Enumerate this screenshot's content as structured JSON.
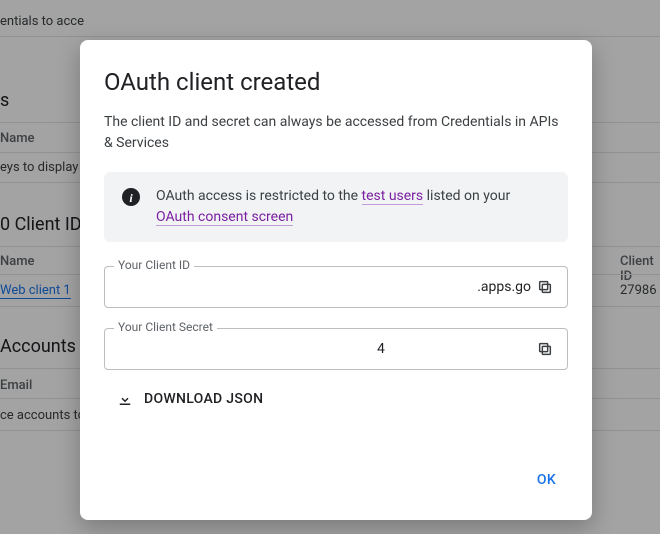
{
  "background": {
    "top_fragment": "entials to acce",
    "section1": {
      "title_suffix": "s",
      "col_name": "Name",
      "row1": "eys to display"
    },
    "section2": {
      "title_fragment": "0 Client ID",
      "col_name": "Name",
      "row_link": "Web client 1",
      "col_clientid": "Client ID",
      "clientid_fragment": "27986"
    },
    "section3": {
      "title_fragment": "Accounts",
      "col_email": "Email",
      "row_fragment": "ce accounts to"
    }
  },
  "dialog": {
    "title": "OAuth client created",
    "intro": "The client ID and secret can always be accessed from Credentials in APIs & Services",
    "notice_pre": "OAuth access is restricted to the ",
    "notice_link1": "test users",
    "notice_mid": " listed on your ",
    "notice_link2": "OAuth consent screen",
    "client_id_label": "Your Client ID",
    "client_id_suffix": ".apps.go",
    "client_secret_label": "Your Client Secret",
    "client_secret_suffix": "4",
    "download_label": "DOWNLOAD JSON",
    "ok_label": "OK"
  }
}
